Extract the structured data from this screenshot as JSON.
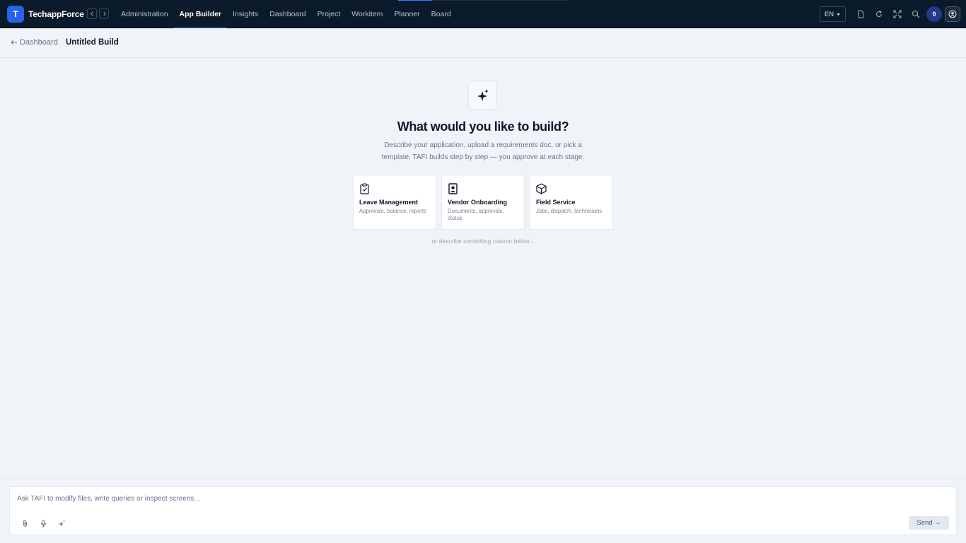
{
  "app": {
    "logo_letter": "T",
    "brand": "TechappForce"
  },
  "nav": {
    "items": [
      {
        "label": "Administration",
        "active": false
      },
      {
        "label": "App Builder",
        "active": true
      },
      {
        "label": "Insights",
        "active": false
      },
      {
        "label": "Dashboard",
        "active": false
      },
      {
        "label": "Project",
        "active": false
      },
      {
        "label": "Workitem",
        "active": false
      },
      {
        "label": "Planner",
        "active": false
      },
      {
        "label": "Board",
        "active": false
      }
    ],
    "language": "EN",
    "notification_count": "0",
    "load_progress": 0.2
  },
  "breadcrumb": {
    "back_label": "Dashboard",
    "title": "Untitled Build"
  },
  "hero": {
    "title": "What would you like to build?",
    "description": "Describe your application, upload a requirements doc, or pick a template. TAFI builds step by step — you approve at each stage."
  },
  "templates": [
    {
      "icon": "clipboard-check-icon",
      "title": "Leave Management",
      "subtitle": "Approvals, balance, reports"
    },
    {
      "icon": "id-badge-icon",
      "title": "Vendor Onboarding",
      "subtitle": "Documents, approvals, status"
    },
    {
      "icon": "box-icon",
      "title": "Field Service",
      "subtitle": "Jobs, dispatch, technicians"
    }
  ],
  "hint": "or describe something custom below ↓",
  "composer": {
    "placeholder": "Ask TAFI to modify files, write queries or inspect screens...",
    "value": "",
    "send_label": "Send →"
  },
  "colors": {
    "topbar": "#0b1a2b",
    "accent": "#2563eb",
    "background": "#f0f4f8"
  }
}
